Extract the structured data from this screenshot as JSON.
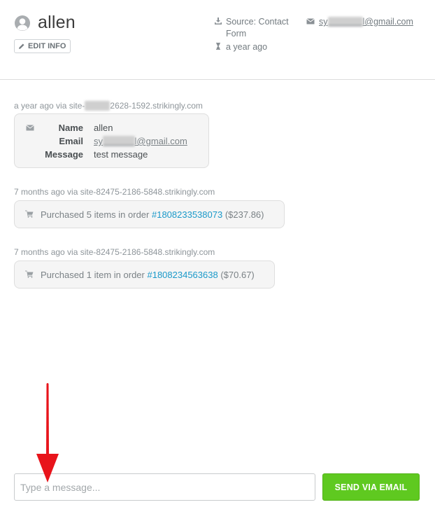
{
  "contact": {
    "name": "allen",
    "edit_label": "EDIT INFO",
    "source": "Source: Contact Form",
    "time": "a year ago",
    "email_prefix": "sy",
    "email_masked": "xxxxxxxx",
    "email_suffix": "l@gmail.com"
  },
  "activity": [
    {
      "ts_prefix": "a year ago via site-",
      "ts_masked": "xxxxxx",
      "ts_suffix": "2628-1592.strikingly.com",
      "form": {
        "name_label": "Name",
        "name_value": "allen",
        "email_label": "Email",
        "email_prefix": "sy",
        "email_masked": "xxxxxxx",
        "email_suffix": "l@gmail.com",
        "message_label": "Message",
        "message_value": "test message"
      }
    },
    {
      "ts": "7 months ago via site-82475-2186-5848.strikingly.com",
      "text": "Purchased 5 items in order",
      "order": "#1808233538073",
      "amount": "($237.86)"
    },
    {
      "ts": "7 months ago via site-82475-2186-5848.strikingly.com",
      "text": "Purchased 1 item in order",
      "order": "#1808234563638",
      "amount": "($70.67)"
    }
  ],
  "composer": {
    "placeholder": "Type a message...",
    "send_label": "SEND VIA EMAIL"
  },
  "colors": {
    "accent_green": "#5fc920",
    "link_blue": "#1a99c9",
    "annotation_arrow": "#e8141b"
  }
}
